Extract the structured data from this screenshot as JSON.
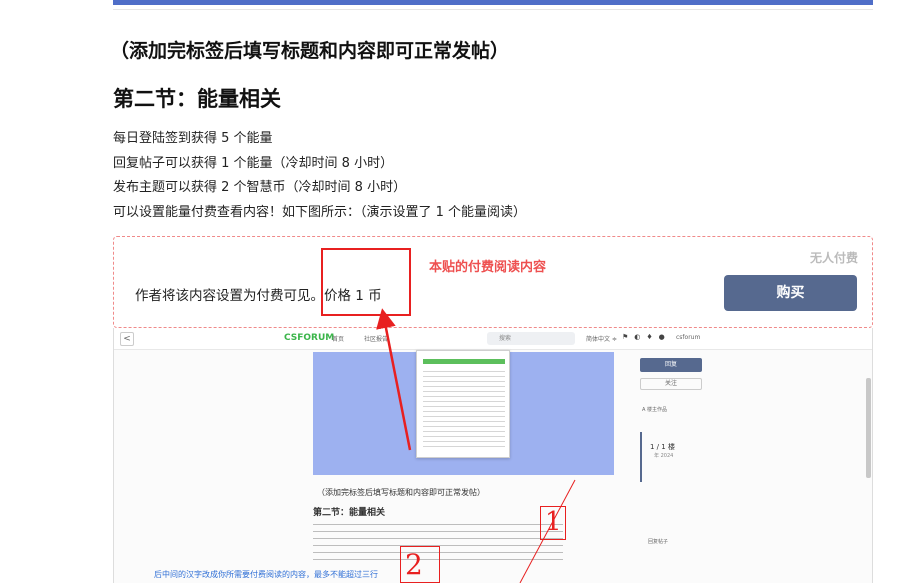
{
  "article": {
    "note_heading": "（添加完标签后填写标题和内容即可正常发帖）",
    "section_heading": "第二节：能量相关",
    "lines": [
      "每日登陆签到获得 5 个能量",
      "回复帖子可以获得 1 个能量（冷却时间 8 小时）",
      "发布主题可以获得 2 个智慧币（冷却时间 8 小时）",
      "可以设置能量付费查看内容！如下图所示：（演示设置了 1 个能量阅读）"
    ]
  },
  "paywall": {
    "text": "作者将该内容设置为付费可见。价格 1 币",
    "no_payer": "无人付费",
    "buy_label": "购买",
    "annotation": "本贴的付费阅读内容"
  },
  "screenshot": {
    "back": "<",
    "logo": "CSFORUM",
    "home": "首页",
    "ticker": "社区报告",
    "search_placeholder": "搜索",
    "language": "简体中文 ≑",
    "icons": "⚑◐♦●",
    "user": "csforum",
    "reply_button": "回复",
    "follow_button": "关注",
    "owner": "A 楼主作品",
    "date": "1 / 1 楼",
    "year": "年 2024",
    "reply": "回复帖子",
    "note": "（添加完标签后填写标题和内容即可正常发帖）",
    "section": "第二节：能量相关",
    "blue_text": "后中间的汉字改成你所需要付费阅读的内容，最多不能超过三行",
    "hand_1": "1",
    "hand_2": "2"
  },
  "colors": {
    "accent": "#4f6ec8",
    "buy": "#56698f",
    "annotation": "#e82020",
    "dashed_border": "#f08a8a"
  }
}
